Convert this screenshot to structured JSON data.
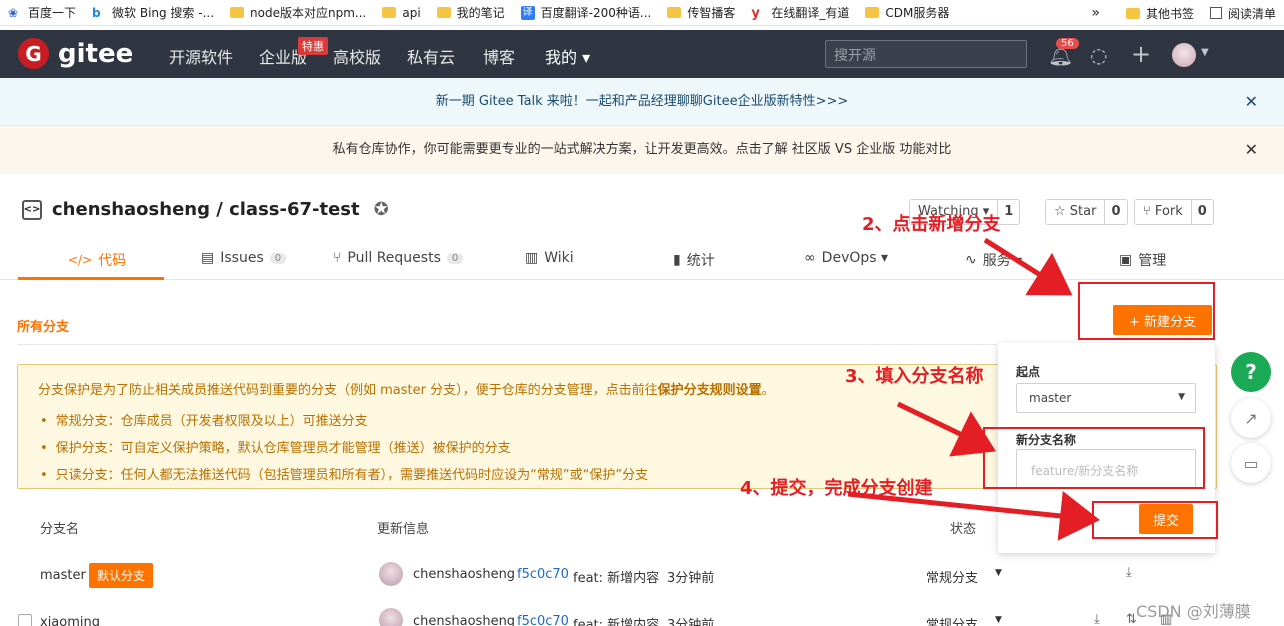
{
  "bookmarks": [
    "百度一下",
    "微软 Bing 搜索 -...",
    "node版本对应npm...",
    "api",
    "我的笔记",
    "百度翻译-200种语...",
    "传智播客",
    "在线翻译_有道",
    "CDM服务器"
  ],
  "bookmarks_more": "»",
  "bookmarks_right": [
    "其他书签",
    "阅读清单"
  ],
  "header": {
    "logo_text": "gitee",
    "logo_letter": "G",
    "nav": [
      "开源软件",
      "企业版",
      "高校版",
      "私有云",
      "博客",
      "我的 ▾"
    ],
    "tejia": "特惠",
    "search_placeholder": "搜开源",
    "notif_count": "56"
  },
  "banner1": "新一期 Gitee Talk 来啦！一起和产品经理聊聊Gitee企业版新特性>>>",
  "banner2": "私有仓库协作，你可能需要更专业的一站式解决方案，让开发更高效。点击了解 社区版 VS 企业版 功能对比",
  "repo": {
    "title": "chenshaosheng / class-67-test",
    "watching_label": "Watching ▾",
    "watching_count": "1",
    "star_label": "☆ Star",
    "star_count": "0",
    "fork_label": "⑂ Fork",
    "fork_count": "0"
  },
  "tabs": [
    {
      "label": "代码",
      "icon": "</>"
    },
    {
      "label": "Issues",
      "count": "0"
    },
    {
      "label": "Pull Requests",
      "count": "0"
    },
    {
      "label": "Wiki"
    },
    {
      "label": "统计"
    },
    {
      "label": "DevOps ▾"
    },
    {
      "label": "服务 ▾"
    },
    {
      "label": "管理"
    }
  ],
  "all_branches": "所有分支",
  "new_branch": "+ 新建分支",
  "info": {
    "line1_a": "分支保护是为了防止相关成员推送代码到重要的分支（例如 master 分支），便于仓库的分支管理，点击前往",
    "line1_b": "保护分支规则设置",
    "line1_c": "。",
    "items": [
      "常规分支：仓库成员（开发者权限及以上）可推送分支",
      "保护分支：可自定义保护策略，默认仓库管理员才能管理（推送）被保护的分支",
      "只读分支：任何人都无法推送代码（包括管理员和所有者），需要推送代码时应设为“常规”或“保护”分支"
    ]
  },
  "popup": {
    "origin_label": "起点",
    "origin_value": "master",
    "name_label": "新分支名称",
    "name_placeholder": "feature/新分支名称",
    "submit": "提交"
  },
  "table": {
    "headers": [
      "分支名",
      "更新信息",
      "状态"
    ],
    "rows": [
      {
        "branch": "master",
        "tag": "默认分支",
        "author": "chenshaosheng",
        "hash": "f5c0c70",
        "msg": "feat: 新增内容",
        "time": "3分钟前",
        "status": "常规分支"
      },
      {
        "branch": "xiaoming",
        "author": "chenshaosheng",
        "hash": "f5c0c70",
        "msg": "feat: 新增内容",
        "time": "3分钟前",
        "status": "常规分支"
      }
    ]
  },
  "annotations": {
    "step2": "2、点击新增分支",
    "step3": "3、填入分支名称",
    "step4": "4、提交，完成分支创建"
  },
  "watermark": "CSDN @刘薄膜",
  "colors": {
    "accent": "#fe7300",
    "header": "#303641",
    "annotation": "#e31e24"
  }
}
